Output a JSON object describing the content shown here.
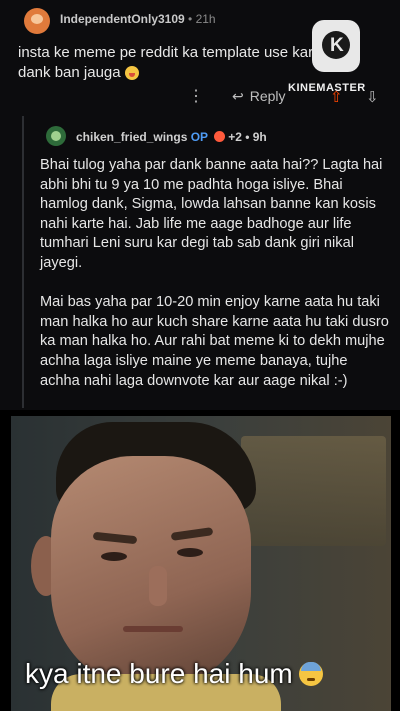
{
  "parent_comment": {
    "username": "IndependentOnly3109",
    "separator": " • ",
    "time": "21h",
    "text": "insta ke meme pe reddit ka template use karleta hu dank ban jauga",
    "emoji_icon": "tongue-out-emoji-icon",
    "more_label": "⋮",
    "reply_label": "Reply",
    "reply_icon": "↩"
  },
  "watermark": {
    "logo_icon": "kinemaster-logo-icon",
    "text": "KINEMASTER"
  },
  "reply_comment": {
    "username": "chiken_fried_wings",
    "op_tag": "OP",
    "award_count": "+2",
    "separator": " • ",
    "time": "9h",
    "paragraph1": "Bhai tulog yaha par dank banne aata hai?? Lagta hai abhi bhi tu 9 ya 10 me padhta hoga isliye. Bhai hamlog dank, Sigma, lowda lahsan banne kan kosis nahi karte hai. Jab life me aage badhoge aur life tumhari Leni suru kar degi tab sab dank giri nikal jayegi.",
    "paragraph2": "Mai bas yaha par 10-20 min enjoy karne aata hu taki man halka ho aur kuch share karne aata hu taki dusro ka man halka ho. Aur rahi bat meme ki to dekh mujhe achha laga isliye maine ye meme banaya, tujhe achha nahi laga downvote kar aur aage nikal :-)"
  },
  "meme": {
    "caption": "kya itne bure hai hum",
    "caption_emoji": "sweat-face-emoji-icon"
  },
  "colors": {
    "background": "#0c0c0e",
    "upvote": "#ff4500",
    "op_tag": "#4f9cf5"
  }
}
